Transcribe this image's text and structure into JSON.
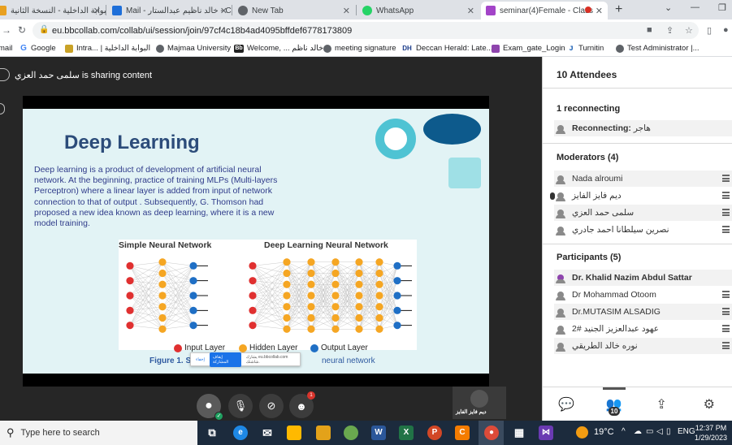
{
  "browser": {
    "tabs": [
      {
        "label": "البوابة الداخلية - النسخة الثانية",
        "color": "#e8a020"
      },
      {
        "label": "Mail - خالد ناظيم عبدالستار - C",
        "color": "#1e6fd9"
      },
      {
        "label": "New Tab",
        "color": "#5f6368"
      },
      {
        "label": "WhatsApp",
        "color": "#25d366"
      },
      {
        "label": "seminar(4)Female - Class",
        "color": "#a344c8"
      }
    ],
    "url": "eu.bbcollab.com/collab/ui/session/join/97cf4c18b4ad4095bffdef6778173809",
    "bookmarks": [
      {
        "label": "mail"
      },
      {
        "label": "Google",
        "icon": "G"
      },
      {
        "label": "Intra... | البوابة الداخلية"
      },
      {
        "label": "Majmaa University"
      },
      {
        "label": "Welcome, ... خالد ناظم",
        "icon": "Bb"
      },
      {
        "label": "meeting signature"
      },
      {
        "label": "Deccan Herald: Late...",
        "icon": "DH"
      },
      {
        "label": "Exam_gate_Login"
      },
      {
        "label": "Turnitin"
      },
      {
        "label": "Test Administrator |..."
      }
    ]
  },
  "stage": {
    "sharing_text": "سلمى حمد العزي is sharing content",
    "slide": {
      "title": "Deep Learning",
      "body": "Deep learning is a product of development of artificial neural network. At the beginning, practice of training MLPs (Multi-layers Perceptron) where a linear layer is added from input of network connection to that of output . Subsequently, G. Thomson had proposed a new idea known as deep learning, where it is a new model training.",
      "simple_nn_label": "Simple Neural Network",
      "deep_nn_label": "Deep Learning Neural Network",
      "legend": [
        {
          "label": "Input Layer",
          "color": "#e03030"
        },
        {
          "label": "Hidden Layer",
          "color": "#f5a623"
        },
        {
          "label": "Output Layer",
          "color": "#1f6fc5"
        }
      ],
      "figure_caption_bold": "Figure 1. Si",
      "figure_caption_rest": "neural network"
    },
    "share_bar": {
      "hide": "إخفاء",
      "stop": "إيقاف المشاركة",
      "message": "يشارك eu.bbcollab.com شاشتك."
    },
    "self_tile_name": "ديم فايز الفايز",
    "controls_badge": "1"
  },
  "panel": {
    "title": "10 Attendees",
    "reconnecting": {
      "heading": "1 reconnecting",
      "row_label": "Reconnecting:",
      "row_name": "هاجر"
    },
    "moderators": {
      "heading": "Moderators (4)",
      "items": [
        "Nada alroumi",
        "ديم فايز الفايز",
        "سلمى حمد العزي",
        "نصرين سيلطانا احمد جادري"
      ]
    },
    "participants": {
      "heading": "Participants (5)",
      "items": [
        "Dr. Khalid Nazim Abdul Sattar",
        "Dr Mohammad Otoom",
        "Dr.MUTASIM ALSADIG",
        "عهود عبدالعزيز الجنيد #2",
        "نوره خالد الطريقي"
      ]
    },
    "attendee_count": "10"
  },
  "taskbar": {
    "search_placeholder": "Type here to search",
    "temperature": "19°C",
    "language": "ENG",
    "time": "12:37 PM",
    "date": "1/29/2023"
  }
}
